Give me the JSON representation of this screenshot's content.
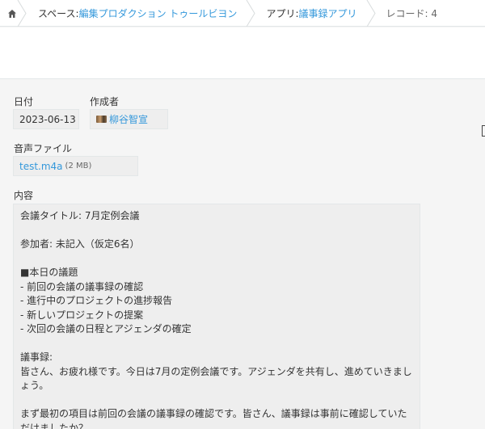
{
  "breadcrumb": {
    "space_prefix": "スペース: ",
    "space_name": "編集プロダクション トゥールビヨン",
    "app_prefix": "アプリ: ",
    "app_name": "議事録アプリ",
    "record_label": "レコード: 4"
  },
  "fields": {
    "date_label": "日付",
    "date_value": "2023-06-13",
    "author_label": "作成者",
    "author_value": "柳谷智宣",
    "audio_label": "音声ファイル",
    "audio_file": "test.m4a",
    "audio_size": "(2 MB)",
    "content_label": "内容"
  },
  "content_lines": [
    "会議タイトル: 7月定例会議",
    "",
    "参加者: 未記入（仮定6名）",
    "",
    "■本日の議題",
    "- 前回の会議の議事録の確認",
    "- 進行中のプロジェクトの進捗報告",
    "- 新しいプロジェクトの提案",
    "- 次回の会議の日程とアジェンダの確定",
    "",
    "議事録:",
    "皆さん、お疲れ様です。今日は7月の定例会議です。アジェンダを共有し、進めていきましょう。",
    "",
    "まず最初の項目は前回の会議の議事録の確認です。皆さん、議事録は事前に確認していただけましたか？"
  ],
  "icons": {
    "home": "home-icon",
    "chevron": "chevron-right-icon",
    "avatar": "user-avatar"
  },
  "colors": {
    "link": "#3498db",
    "field_bg": "#eeeeee",
    "page_bg": "#f5f5f5"
  }
}
